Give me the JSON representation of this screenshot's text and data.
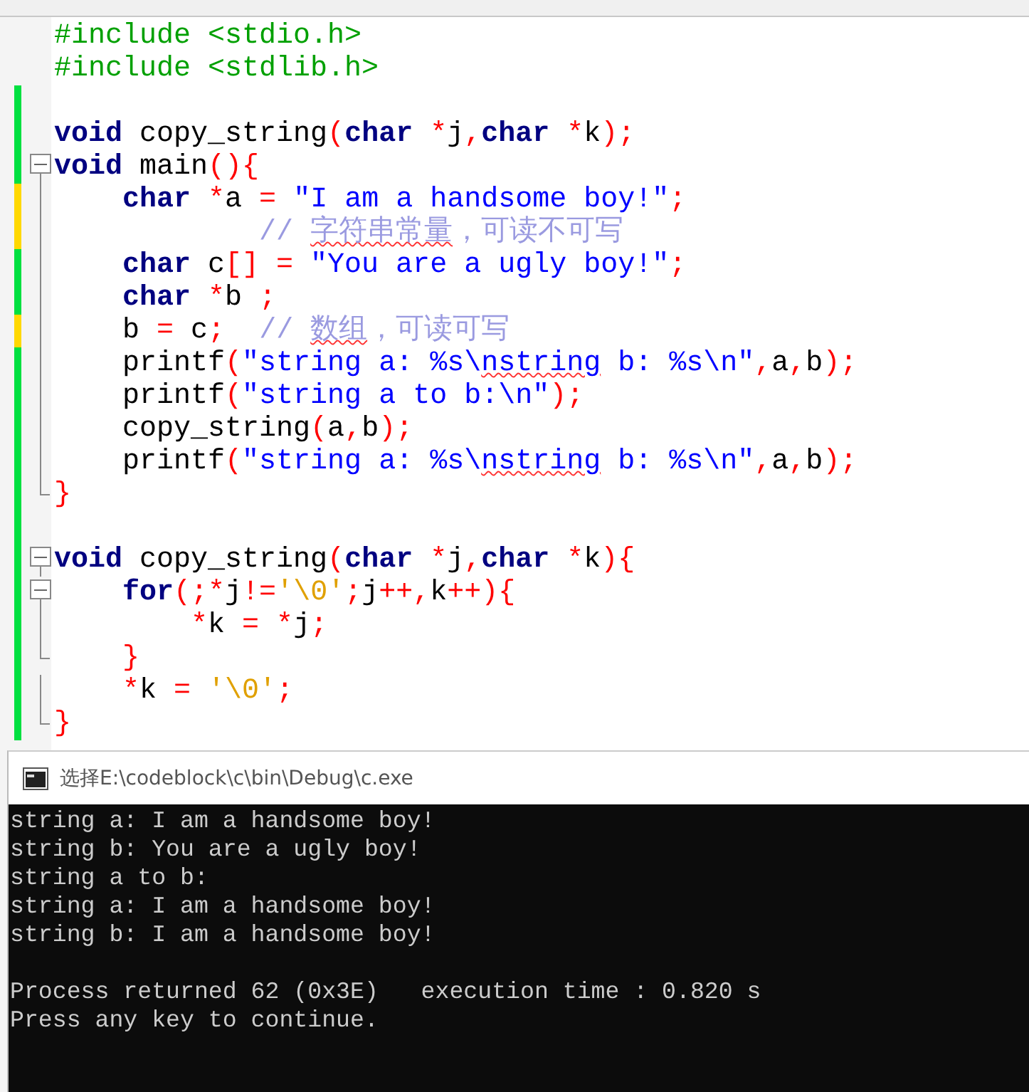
{
  "editor": {
    "lines": [
      {
        "fold_toggle": false,
        "fold_guide": false,
        "fold_end": false,
        "tokens": [
          {
            "kind": "pre",
            "text": "#include <stdio.h>"
          }
        ]
      },
      {
        "fold_toggle": false,
        "fold_guide": false,
        "fold_end": false,
        "tokens": [
          {
            "kind": "pre",
            "text": "#include <stdlib.h>"
          }
        ]
      },
      {
        "color": "#00e040",
        "fold_toggle": false,
        "fold_guide": false,
        "fold_end": false
      },
      {
        "color": "#00e040",
        "fold_toggle": false,
        "fold_guide": false,
        "fold_end": false,
        "tokens": [
          {
            "kind": "kw",
            "text": "void"
          },
          {
            "kind": "plain",
            "text": " copy_string"
          },
          {
            "kind": "punct",
            "text": "("
          },
          {
            "kind": "kw",
            "text": "char"
          },
          {
            "kind": "punct",
            "text": " *"
          },
          {
            "kind": "plain",
            "text": "j"
          },
          {
            "kind": "punct",
            "text": ","
          },
          {
            "kind": "kw",
            "text": "char"
          },
          {
            "kind": "punct",
            "text": " *"
          },
          {
            "kind": "plain",
            "text": "k"
          },
          {
            "kind": "punct",
            "text": ");"
          }
        ]
      },
      {
        "color": "#00e040",
        "fold_toggle": true,
        "fold_guide": false,
        "fold_end": false,
        "tokens": [
          {
            "kind": "kw",
            "text": "void"
          },
          {
            "kind": "plain",
            "text": " main"
          },
          {
            "kind": "punct",
            "text": "(){"
          }
        ]
      },
      {
        "color": "#ffd800",
        "fold_toggle": false,
        "fold_guide": true,
        "fold_end": false,
        "tokens": [
          {
            "kind": "kw",
            "text": "    char"
          },
          {
            "kind": "punct",
            "text": " *"
          },
          {
            "kind": "plain",
            "text": "a "
          },
          {
            "kind": "punct",
            "text": "="
          },
          {
            "kind": "str",
            "text": " \"I am a handsome boy!\""
          },
          {
            "kind": "punct",
            "text": ";"
          }
        ]
      },
      {
        "color": "#ffd800",
        "fold_toggle": false,
        "fold_guide": true,
        "fold_end": false,
        "tokens": [
          {
            "kind": "comment",
            "text": "            // "
          },
          {
            "kind": "comment",
            "text": "字符串常量",
            "misspelled": true
          },
          {
            "kind": "comment",
            "text": "，可读不可写"
          }
        ]
      },
      {
        "color": "#00e040",
        "fold_toggle": false,
        "fold_guide": true,
        "fold_end": false,
        "tokens": [
          {
            "kind": "kw",
            "text": "    char"
          },
          {
            "kind": "plain",
            "text": " c"
          },
          {
            "kind": "punct",
            "text": "[] ="
          },
          {
            "kind": "str",
            "text": " \"You are a ugly boy!\""
          },
          {
            "kind": "punct",
            "text": ";"
          }
        ]
      },
      {
        "color": "#00e040",
        "fold_toggle": false,
        "fold_guide": true,
        "fold_end": false,
        "tokens": [
          {
            "kind": "kw",
            "text": "    char"
          },
          {
            "kind": "punct",
            "text": " *"
          },
          {
            "kind": "plain",
            "text": "b "
          },
          {
            "kind": "punct",
            "text": ";"
          }
        ]
      },
      {
        "color": "#ffd800",
        "fold_toggle": false,
        "fold_guide": true,
        "fold_end": false,
        "tokens": [
          {
            "kind": "plain",
            "text": "    b "
          },
          {
            "kind": "punct",
            "text": "="
          },
          {
            "kind": "plain",
            "text": " c"
          },
          {
            "kind": "punct",
            "text": ";"
          },
          {
            "kind": "comment",
            "text": "  // "
          },
          {
            "kind": "comment",
            "text": "数组",
            "misspelled": true
          },
          {
            "kind": "comment",
            "text": "，可读可写"
          }
        ]
      },
      {
        "color": "#00e040",
        "fold_toggle": false,
        "fold_guide": true,
        "fold_end": false,
        "tokens": [
          {
            "kind": "plain",
            "text": "    printf"
          },
          {
            "kind": "punct",
            "text": "("
          },
          {
            "kind": "str",
            "text": "\"string a: %s\\"
          },
          {
            "kind": "str",
            "text": "nstring",
            "misspelled": true
          },
          {
            "kind": "str",
            "text": " b: %s\\n\""
          },
          {
            "kind": "punct",
            "text": ","
          },
          {
            "kind": "plain",
            "text": "a"
          },
          {
            "kind": "punct",
            "text": ","
          },
          {
            "kind": "plain",
            "text": "b"
          },
          {
            "kind": "punct",
            "text": ");"
          }
        ]
      },
      {
        "color": "#00e040",
        "fold_toggle": false,
        "fold_guide": true,
        "fold_end": false,
        "tokens": [
          {
            "kind": "plain",
            "text": "    printf"
          },
          {
            "kind": "punct",
            "text": "("
          },
          {
            "kind": "str",
            "text": "\"string a to b:\\n\""
          },
          {
            "kind": "punct",
            "text": ");"
          }
        ]
      },
      {
        "color": "#00e040",
        "fold_toggle": false,
        "fold_guide": true,
        "fold_end": false,
        "tokens": [
          {
            "kind": "plain",
            "text": "    copy_string"
          },
          {
            "kind": "punct",
            "text": "("
          },
          {
            "kind": "plain",
            "text": "a"
          },
          {
            "kind": "punct",
            "text": ","
          },
          {
            "kind": "plain",
            "text": "b"
          },
          {
            "kind": "punct",
            "text": ");"
          }
        ]
      },
      {
        "color": "#00e040",
        "fold_toggle": false,
        "fold_guide": true,
        "fold_end": false,
        "tokens": [
          {
            "kind": "plain",
            "text": "    printf"
          },
          {
            "kind": "punct",
            "text": "("
          },
          {
            "kind": "str",
            "text": "\"string a: %s\\"
          },
          {
            "kind": "str",
            "text": "nstring",
            "misspelled": true
          },
          {
            "kind": "str",
            "text": " b: %s\\n\""
          },
          {
            "kind": "punct",
            "text": ","
          },
          {
            "kind": "plain",
            "text": "a"
          },
          {
            "kind": "punct",
            "text": ","
          },
          {
            "kind": "plain",
            "text": "b"
          },
          {
            "kind": "punct",
            "text": ");"
          }
        ]
      },
      {
        "color": "#00e040",
        "fold_toggle": false,
        "fold_guide": false,
        "fold_end": true,
        "tokens": [
          {
            "kind": "punct",
            "text": "}"
          }
        ]
      },
      {
        "color": "#00e040",
        "fold_toggle": false,
        "fold_guide": false,
        "fold_end": false
      },
      {
        "color": "#00e040",
        "fold_toggle": true,
        "fold_guide": false,
        "fold_end": false,
        "tokens": [
          {
            "kind": "kw",
            "text": "void"
          },
          {
            "kind": "plain",
            "text": " copy_string"
          },
          {
            "kind": "punct",
            "text": "("
          },
          {
            "kind": "kw",
            "text": "char"
          },
          {
            "kind": "punct",
            "text": " *"
          },
          {
            "kind": "plain",
            "text": "j"
          },
          {
            "kind": "punct",
            "text": ","
          },
          {
            "kind": "kw",
            "text": "char"
          },
          {
            "kind": "punct",
            "text": " *"
          },
          {
            "kind": "plain",
            "text": "k"
          },
          {
            "kind": "punct",
            "text": "){"
          }
        ]
      },
      {
        "color": "#00e040",
        "fold_toggle": true,
        "fold_guide": false,
        "fold_end": false,
        "tokens": [
          {
            "kind": "kw",
            "text": "    for"
          },
          {
            "kind": "punct",
            "text": "(;*"
          },
          {
            "kind": "plain",
            "text": "j"
          },
          {
            "kind": "punct",
            "text": "!="
          },
          {
            "kind": "chr",
            "text": "'\\0'"
          },
          {
            "kind": "punct",
            "text": ";"
          },
          {
            "kind": "plain",
            "text": "j"
          },
          {
            "kind": "punct",
            "text": "++,"
          },
          {
            "kind": "plain",
            "text": "k"
          },
          {
            "kind": "punct",
            "text": "++){"
          }
        ]
      },
      {
        "color": "#00e040",
        "fold_toggle": false,
        "fold_guide": true,
        "fold_end": false,
        "tokens": [
          {
            "kind": "punct",
            "text": "        *"
          },
          {
            "kind": "plain",
            "text": "k "
          },
          {
            "kind": "punct",
            "text": "= *"
          },
          {
            "kind": "plain",
            "text": "j"
          },
          {
            "kind": "punct",
            "text": ";"
          }
        ]
      },
      {
        "color": "#00e040",
        "fold_toggle": false,
        "fold_guide": false,
        "fold_end": true,
        "tokens": [
          {
            "kind": "punct",
            "text": "    }"
          }
        ]
      },
      {
        "color": "#00e040",
        "fold_toggle": false,
        "fold_guide": true,
        "fold_end": false,
        "tokens": [
          {
            "kind": "punct",
            "text": "    *"
          },
          {
            "kind": "plain",
            "text": "k "
          },
          {
            "kind": "punct",
            "text": "="
          },
          {
            "kind": "chr",
            "text": " '\\0'"
          },
          {
            "kind": "punct",
            "text": ";"
          }
        ]
      },
      {
        "color": "#00e040",
        "fold_toggle": false,
        "fold_guide": false,
        "fold_end": true,
        "tokens": [
          {
            "kind": "punct",
            "text": "}"
          }
        ]
      }
    ]
  },
  "console": {
    "title": "选择E:\\codeblock\\c\\bin\\Debug\\c.exe",
    "output_lines": [
      "string a: I am a handsome boy!",
      "string b: You are a ugly boy!",
      "string a to b:",
      "string a: I am a handsome boy!",
      "string b: I am a handsome boy!"
    ],
    "status_lines": [
      "Process returned 62 (0x3E)   execution time : 0.820 s",
      "Press any key to continue."
    ]
  }
}
